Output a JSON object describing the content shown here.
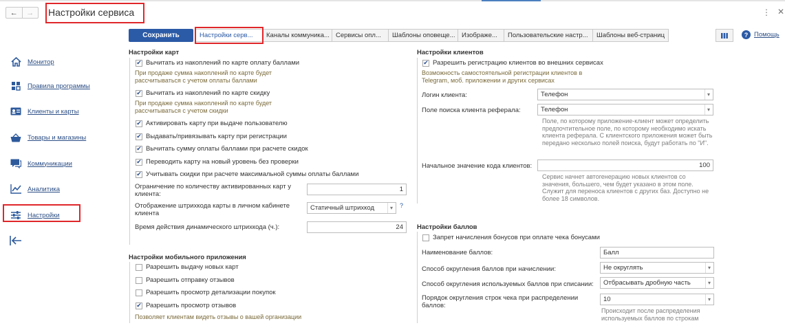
{
  "window": {
    "title": "Настройки сервиса",
    "back_glyph": "←",
    "forward_glyph": "→",
    "kebab_glyph": "⋮",
    "close_glyph": "✕"
  },
  "sidebar": {
    "items": [
      {
        "label": "Монитор",
        "icon": "home-icon"
      },
      {
        "label": "Правила программы",
        "icon": "grid-icon"
      },
      {
        "label": "Клиенты и карты",
        "icon": "id-card-icon"
      },
      {
        "label": "Товары и магазины",
        "icon": "basket-icon"
      },
      {
        "label": "Коммуникации",
        "icon": "chat-icon"
      },
      {
        "label": "Аналитика",
        "icon": "chart-icon"
      },
      {
        "label": "Настройки",
        "icon": "sliders-icon"
      }
    ],
    "back_icon": "collapse-arrow-icon"
  },
  "toolbar": {
    "save_label": "Сохранить",
    "tabs": [
      "Настройки серв...",
      "Каналы коммуника...",
      "Сервисы опл...",
      "Шаблоны оповеще...",
      "Изображе...",
      "Пользовательские настр...",
      "Шаблоны веб-страниц"
    ],
    "help_label": "Помощь",
    "help_glyph": "?"
  },
  "cards": {
    "title": "Настройки карт",
    "opt1": {
      "label": "Вычитать из накоплений по карте оплату баллами",
      "checked": true
    },
    "hint1": "При продаже сумма накоплений по карте будет рассчитываться с учетом оплаты баллами",
    "opt2": {
      "label": "Вычитать из накоплений по карте скидку",
      "checked": true
    },
    "hint2": "При продаже сумма накоплений по карте будет рассчитываться с учетом скидки",
    "opt3": {
      "label": "Активировать карту при выдаче пользователю",
      "checked": true
    },
    "opt4": {
      "label": "Выдавать/привязывать карту при регистрации",
      "checked": true
    },
    "opt5": {
      "label": "Вычитать сумму оплаты баллами при расчете скидок",
      "checked": true
    },
    "opt6": {
      "label": "Переводить карту на новый уровень без проверки",
      "checked": true
    },
    "opt7": {
      "label": "Учитывать скидки при расчете максимальной суммы оплаты баллами",
      "checked": true
    },
    "limit_label": "Ограничение по количеству активированных карт у клиента:",
    "limit_value": "1",
    "barcode_label": "Отображение штрихкода карты в личном кабинете клиента",
    "barcode_value": "Статичный штрихкод",
    "barcode_q": "?",
    "dyn_label": "Время действия динамического штрихкода (ч.):",
    "dyn_value": "24"
  },
  "mobile": {
    "title": "Настройки мобильного приложения",
    "opt1": {
      "label": "Разрешить выдачу новых карт",
      "checked": false
    },
    "opt2": {
      "label": "Разрешить отправку отзывов",
      "checked": false
    },
    "opt3": {
      "label": "Разрешить просмотр детализации покупок",
      "checked": false
    },
    "opt4": {
      "label": "Разрешить просмотр отзывов",
      "checked": true
    },
    "hint": "Позволяет клиентам видеть отзывы о вашей организации"
  },
  "clients": {
    "title": "Настройки клиентов",
    "opt1": {
      "label": "Разрешить регистрацию клиентов во внешних сервисах",
      "checked": true
    },
    "hint1": "Возможность самостоятельной регистрации клиентов в Telegram, моб. приложении и других сервисах",
    "login_label": "Логин клиента:",
    "login_value": "Телефон",
    "search_label": "Поле поиска клиента реферала:",
    "search_value": "Телефон",
    "search_hint": "Поле, по которому приложение-клиент может определить предпочтительное поле, по которому необходимо искать клиента реферала. С клиентского приложения может быть передано несколько полей поиска, будут работать по \"И\".",
    "code_label": "Начальное значение кода клиентов:",
    "code_value": "100",
    "code_hint": "Сервис начнет автогенерацию новых клиентов со значения, большего, чем будет указано в этом поле. Служит для переноса клиентов с других баз. Доступно не более 18 символов."
  },
  "points": {
    "title": "Настройки баллов",
    "opt1": {
      "label": "Запрет начисления бонусов при оплате чека бонусами",
      "checked": false
    },
    "name_label": "Наименование баллов:",
    "name_value": "Балл",
    "round_accrual_label": "Способ округления баллов при начислении:",
    "round_accrual_value": "Не округлять",
    "round_write_label": "Способ округления используемых баллов при списании:",
    "round_write_value": "Отбрасывать дробную часть",
    "order_label": "Порядок округления строк чека при распределении баллов:",
    "order_value": "10",
    "order_hint": "Происходит после распределения используемых баллов по строкам"
  },
  "dropdown_glyph": "▾"
}
